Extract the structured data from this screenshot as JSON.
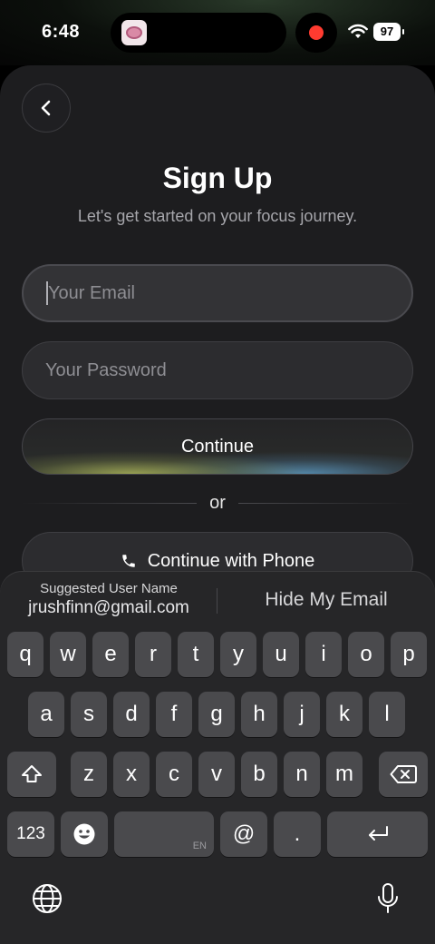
{
  "status_bar": {
    "time": "6:48",
    "battery": "97",
    "icons": [
      "app-thumbnail-icon",
      "recording-dot-icon",
      "wifi-icon",
      "battery-icon"
    ]
  },
  "signup": {
    "title": "Sign Up",
    "subtitle": "Let's get started on your focus journey.",
    "email_placeholder": "Your Email",
    "password_placeholder": "Your Password",
    "continue_label": "Continue",
    "or_label": "or",
    "phone_label": "Continue with Phone"
  },
  "colors": {
    "background": "#1d1d1f",
    "field": "#2c2c2f",
    "record": "#ff3b30",
    "keyboard": "#262628"
  },
  "keyboard": {
    "suggestion_caption": "Suggested User Name",
    "suggestion_value": "jrushfinn@gmail.com",
    "hide_email_label": "Hide My Email",
    "row1": [
      "q",
      "w",
      "e",
      "r",
      "t",
      "y",
      "u",
      "i",
      "o",
      "p"
    ],
    "row2": [
      "a",
      "s",
      "d",
      "f",
      "g",
      "h",
      "j",
      "k",
      "l"
    ],
    "row3": [
      "z",
      "x",
      "c",
      "v",
      "b",
      "n",
      "m"
    ],
    "numbers_label": "123",
    "space_lang": "EN",
    "at_label": "@",
    "dot_label": "."
  }
}
